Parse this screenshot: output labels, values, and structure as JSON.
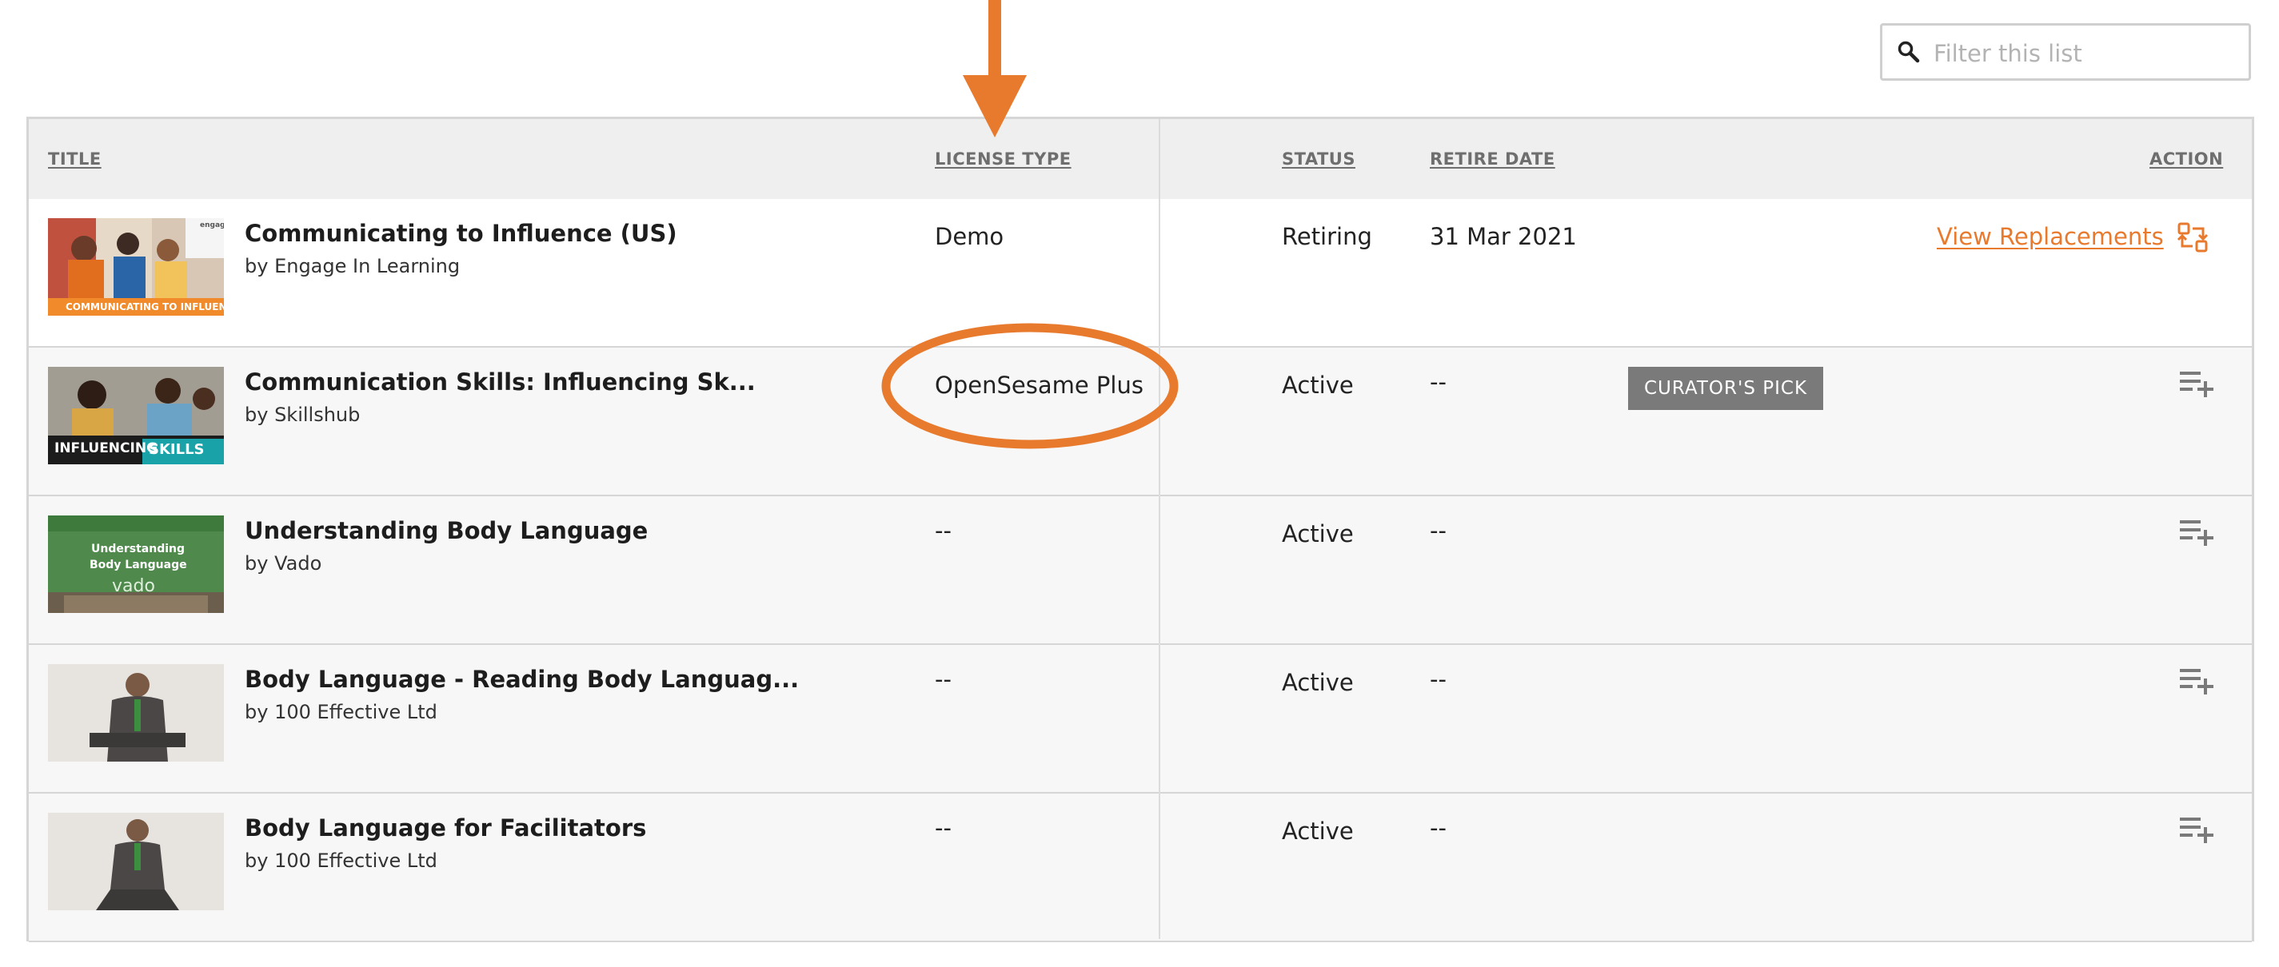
{
  "filter": {
    "placeholder": "Filter this list",
    "icon": "search-icon"
  },
  "table": {
    "columns": {
      "title": "TITLE",
      "license_type": "LICENSE TYPE",
      "status": "STATUS",
      "retire_date": "RETIRE DATE",
      "action": "ACTION"
    },
    "rows": [
      {
        "thumb_text": "COMMUNICATING TO INFLUENCE",
        "thumb_brand": "engage learning",
        "title": "Communicating to Influence (US)",
        "author": "by Engage In Learning",
        "license": "Demo",
        "status": "Retiring",
        "retire_date": "31 Mar 2021",
        "action_link": "View Replacements",
        "action_icon": "swap-icon"
      },
      {
        "thumb_text_1": "INFLUENCING",
        "thumb_text_2": "SKILLS",
        "title": "Communication Skills: Influencing Sk...",
        "author": "by Skillshub",
        "license": "OpenSesame Plus",
        "status": "Active",
        "retire_date": "--",
        "badge": "CURATOR'S PICK",
        "action_icon": "add-to-list-icon"
      },
      {
        "thumb_text_1": "Understanding",
        "thumb_text_2": "Body Language",
        "thumb_brand": "vado",
        "title": "Understanding Body Language",
        "author": "by Vado",
        "license": "--",
        "status": "Active",
        "retire_date": "--",
        "action_icon": "add-to-list-icon"
      },
      {
        "title": "Body Language - Reading Body Languag...",
        "author": "by 100 Effective Ltd",
        "license": "--",
        "status": "Active",
        "retire_date": "--",
        "action_icon": "add-to-list-icon"
      },
      {
        "title": "Body Language for Facilitators",
        "author": "by 100 Effective Ltd",
        "license": "--",
        "status": "Active",
        "retire_date": "--",
        "action_icon": "add-to-list-icon"
      }
    ]
  },
  "colors": {
    "accent": "#e87a2e",
    "badge": "#7a7a7a",
    "header_bg": "#efefef",
    "row_alt_bg": "#f7f7f7"
  }
}
